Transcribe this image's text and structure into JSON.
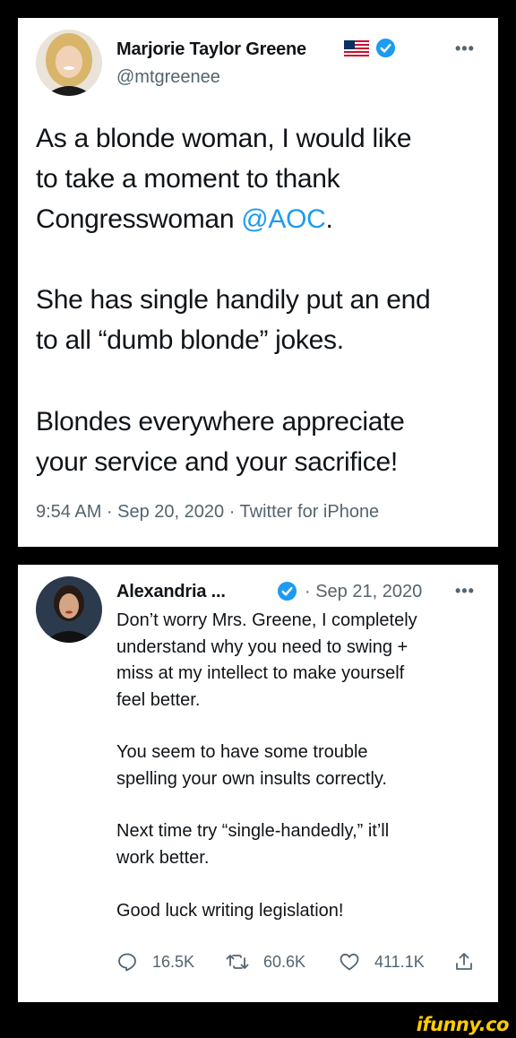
{
  "tweet1": {
    "author_name": "Marjorie Taylor Greene",
    "author_flag": "us-flag",
    "verified_icon": "verified-badge-icon",
    "handle": "@mtgreenee",
    "more_label": "•••",
    "para1_line1": "As a blonde woman, I would like",
    "para1_line2": "to take a moment to thank",
    "para1_line3_prefix": "Congresswoman ",
    "para1_mention": "@AOC",
    "para1_line3_suffix": ".",
    "para2_line1": "She has single handily put an end",
    "para2_line2": "to all “dumb blonde” jokes.",
    "para3_line1": "Blondes everywhere appreciate",
    "para3_line2": "your service and your sacrifice!",
    "timestamp": "9:54 AM · Sep 20, 2020 · Twitter for iPhone"
  },
  "tweet2": {
    "author_name": "Alexandria ...",
    "verified_icon": "verified-badge-icon",
    "date": "· Sep 21, 2020",
    "more_label": "•••",
    "para1_line1": "Don’t worry Mrs. Greene, I completely",
    "para1_line2": "understand why you need to swing +",
    "para1_line3": "miss at my intellect to make yourself",
    "para1_line4": "feel better.",
    "para2_line1": "You seem to have some trouble",
    "para2_line2": "spelling your own insults correctly.",
    "para3_line1": "Next time try “single-handedly,” it’ll",
    "para3_line2": "work better.",
    "para4_line1": "Good luck writing legislation!",
    "actions": {
      "replies": "16.5K",
      "retweets": "60.6K",
      "likes": "411.1K"
    }
  },
  "watermark": "ifunny.co",
  "colors": {
    "background": "#000000",
    "card": "#ffffff",
    "text": "#0f1419",
    "secondary": "#536471",
    "accent": "#1d9bf0",
    "watermark": "#ffcc00"
  }
}
